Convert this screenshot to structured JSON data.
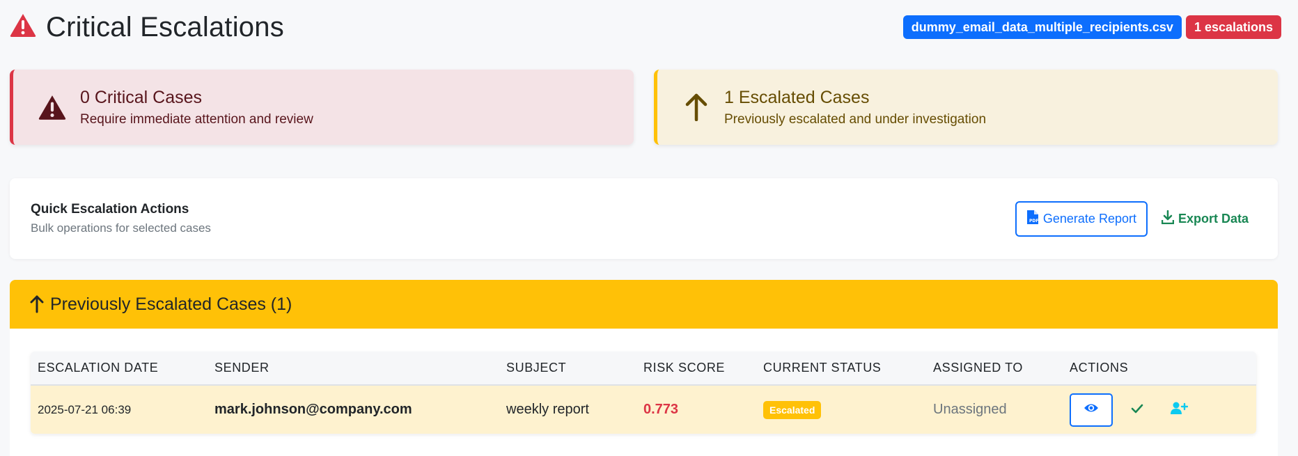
{
  "header": {
    "title": "Critical Escalations",
    "title_icon": "warning-triangle-icon",
    "file_badge": "dummy_email_data_multiple_recipients.csv",
    "count_badge": "1 escalations"
  },
  "stats": {
    "critical": {
      "title": "0 Critical Cases",
      "subtitle": "Require immediate attention and review",
      "icon": "warning-triangle-icon"
    },
    "escalated": {
      "title": "1 Escalated Cases",
      "subtitle": "Previously escalated and under investigation",
      "icon": "arrow-up-icon"
    }
  },
  "quick_actions": {
    "title": "Quick Escalation Actions",
    "subtitle": "Bulk operations for selected cases",
    "generate_report": "Generate Report",
    "export_data": "Export Data"
  },
  "escalated_panel": {
    "title": "Previously Escalated Cases (1)",
    "columns": [
      "ESCALATION DATE",
      "SENDER",
      "SUBJECT",
      "RISK SCORE",
      "CURRENT STATUS",
      "ASSIGNED TO",
      "ACTIONS"
    ],
    "rows": [
      {
        "date": "2025-07-21 06:39",
        "sender": "mark.johnson@company.com",
        "subject": "weekly report",
        "risk": "0.773",
        "status": "Escalated",
        "assigned": "Unassigned"
      }
    ]
  },
  "colors": {
    "primary": "#0d6efd",
    "danger": "#dc3545",
    "warning": "#ffc107",
    "success": "#198754",
    "info": "#0dcaf0"
  }
}
